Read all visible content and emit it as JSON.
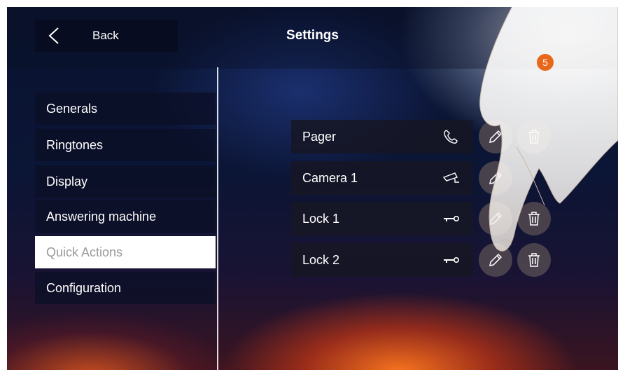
{
  "header": {
    "back_label": "Back",
    "title": "Settings"
  },
  "sidebar": {
    "items": [
      {
        "label": "Generals"
      },
      {
        "label": "Ringtones"
      },
      {
        "label": "Display"
      },
      {
        "label": "Answering machine"
      },
      {
        "label": "Quick Actions",
        "selected": true
      },
      {
        "label": "Configuration"
      }
    ]
  },
  "quick_actions": {
    "items": [
      {
        "label": "Pager",
        "icon": "phone-icon"
      },
      {
        "label": "Camera 1",
        "icon": "camera-icon"
      },
      {
        "label": "Lock 1",
        "icon": "key-icon"
      },
      {
        "label": "Lock 2",
        "icon": "key-icon"
      }
    ]
  },
  "annotation": {
    "step": "5"
  },
  "colors": {
    "accent": "#e8671a",
    "selected_bg": "#ffffff",
    "selected_text": "#9a9a9a"
  }
}
